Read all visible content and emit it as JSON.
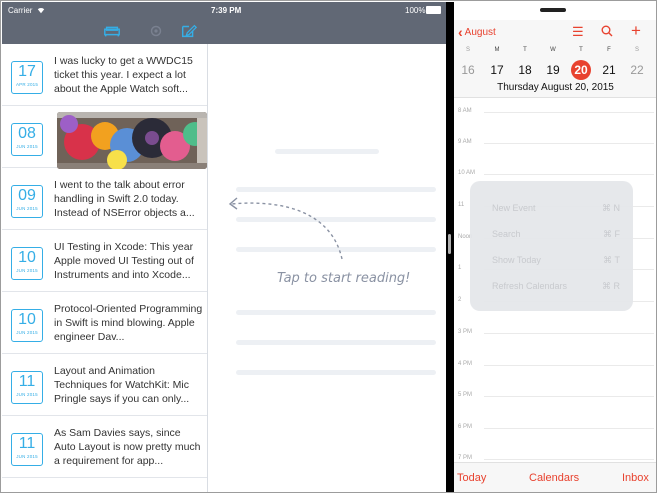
{
  "journal": {
    "status": {
      "carrier": "Carrier",
      "time": "7:39 PM",
      "battery": "100%"
    },
    "entries": [
      {
        "day": "17",
        "month": "APR 2015",
        "text": "I was lucky to get a WWDC15 ticket this year. I expect a lot about the Apple Watch soft..."
      },
      {
        "day": "08",
        "month": "JUN 2015",
        "text": ""
      },
      {
        "day": "09",
        "month": "JUN 2015",
        "text": "I went to the talk about error handling in Swift 2.0 today. Instead of NSError objects a..."
      },
      {
        "day": "10",
        "month": "JUN 2015",
        "text": "UI Testing in Xcode: This year Apple moved UI Testing out of Instruments and into Xcode..."
      },
      {
        "day": "10",
        "month": "JUN 2015",
        "text": "Protocol-Oriented Programming in Swift is mind blowing. Apple engineer Dav..."
      },
      {
        "day": "11",
        "month": "JUN 2015",
        "text": "Layout and Animation Techniques for WatchKit: Mic Pringle says if you can only..."
      },
      {
        "day": "11",
        "month": "JUN 2015",
        "text": "As Sam Davies says, since Auto Layout is now pretty much a requirement for app..."
      }
    ],
    "reader_hint": "Tap to start reading!"
  },
  "calendar": {
    "back_label": "August",
    "weekdays": [
      "S",
      "M",
      "T",
      "W",
      "T",
      "F",
      "S"
    ],
    "days": [
      "16",
      "17",
      "18",
      "19",
      "20",
      "21",
      "22"
    ],
    "date_caption": "Thursday  August 20, 2015",
    "times": [
      "8 AM",
      "9 AM",
      "10 AM",
      "11",
      "Noon",
      "1",
      "2",
      "3 PM",
      "4 PM",
      "5 PM",
      "6 PM",
      "7 PM"
    ],
    "shortcuts": [
      {
        "label": "New Event",
        "keys": "⌘ N"
      },
      {
        "label": "Search",
        "keys": "⌘ F"
      },
      {
        "label": "Show Today",
        "keys": "⌘ T"
      },
      {
        "label": "Refresh Calendars",
        "keys": "⌘ R"
      }
    ],
    "tabs": {
      "today": "Today",
      "calendars": "Calendars",
      "inbox": "Inbox"
    }
  },
  "colors": {
    "nav": "#616875",
    "accent_blue": "#35aee6",
    "accent_red": "#e8422f"
  }
}
